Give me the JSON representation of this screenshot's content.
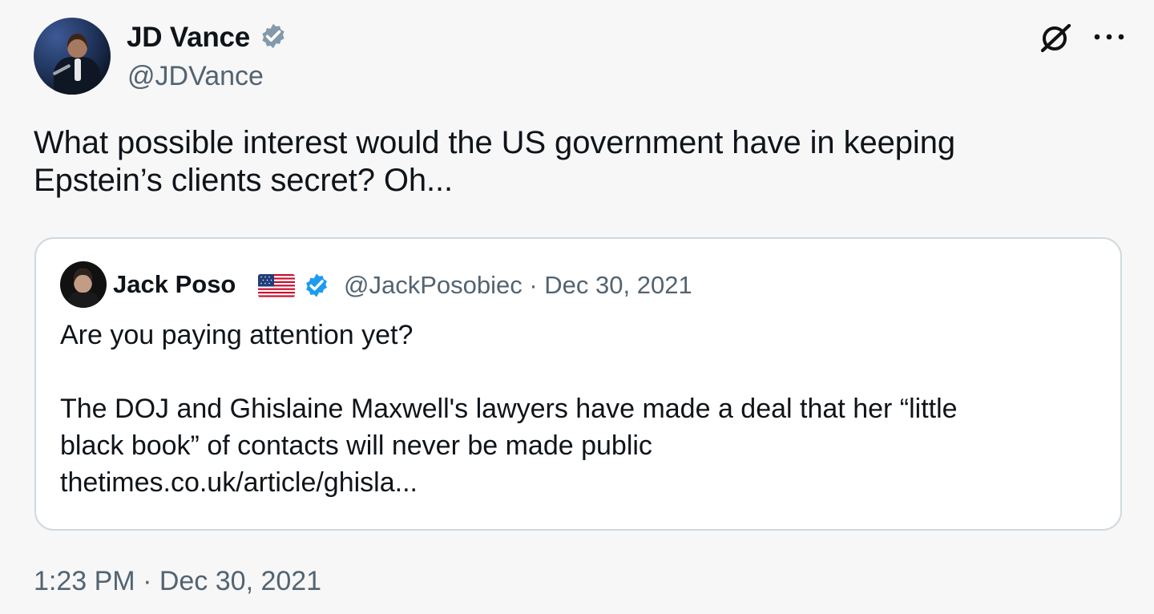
{
  "tweet": {
    "author": {
      "name": "JD Vance",
      "handle": "@JDVance",
      "verified_color": "#829aab"
    },
    "text": "What possible interest would the US government have in keeping\nEpstein’s clients secret? Oh...",
    "timestamp": "1:23 PM · Dec 30, 2021",
    "icons": {
      "grok": "grok-icon",
      "more": "more-options-icon"
    }
  },
  "quoted_tweet": {
    "author": {
      "name": "Jack Poso",
      "flag": "us-flag-icon",
      "verified_color": "#1d9bf0"
    },
    "handle_and_date": "@JackPosobiec · Dec 30, 2021",
    "text": "Are you paying attention yet?\n\nThe DOJ and Ghislaine Maxwell's lawyers have made a deal that her “little\nblack book” of contacts will never be made public\nthetimes.co.uk/article/ghisla..."
  }
}
